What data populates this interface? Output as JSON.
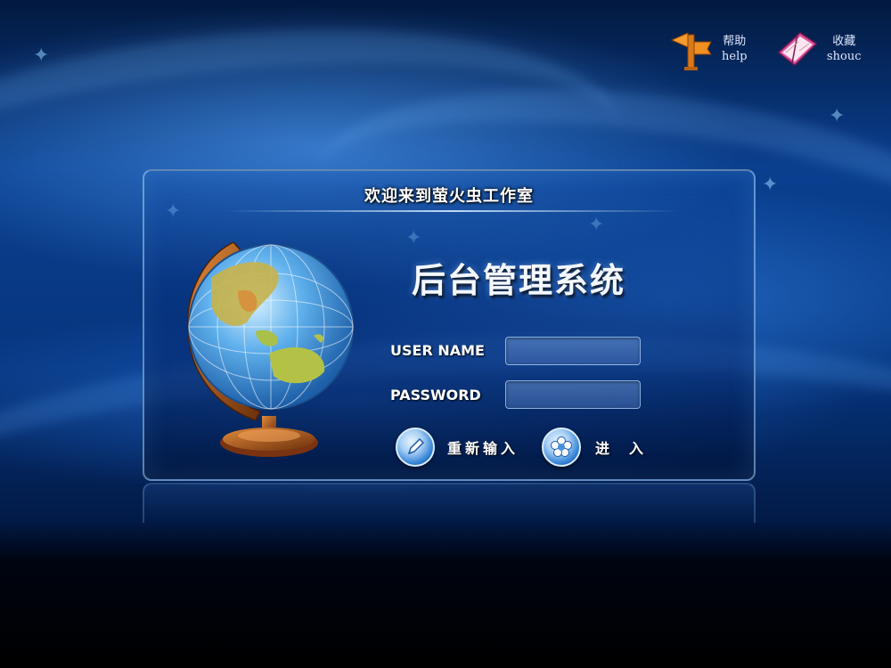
{
  "toolbar": {
    "help": {
      "label_cn": "帮助",
      "label_en": "help",
      "icon": "signpost-icon"
    },
    "favorite": {
      "label_cn": "收藏",
      "label_en": "shouc",
      "icon": "book-icon"
    }
  },
  "panel": {
    "welcome": "欢迎来到萤火虫工作室",
    "title": "后台管理系统"
  },
  "form": {
    "username_label": "USER NAME",
    "username_value": "",
    "password_label": "PASSWORD",
    "password_value": "",
    "reset_label": "重新输入",
    "login_label": "进入"
  },
  "colors": {
    "accent": "#1d5fc7",
    "panel_border": "#aad7ff",
    "text": "#ffffff"
  }
}
